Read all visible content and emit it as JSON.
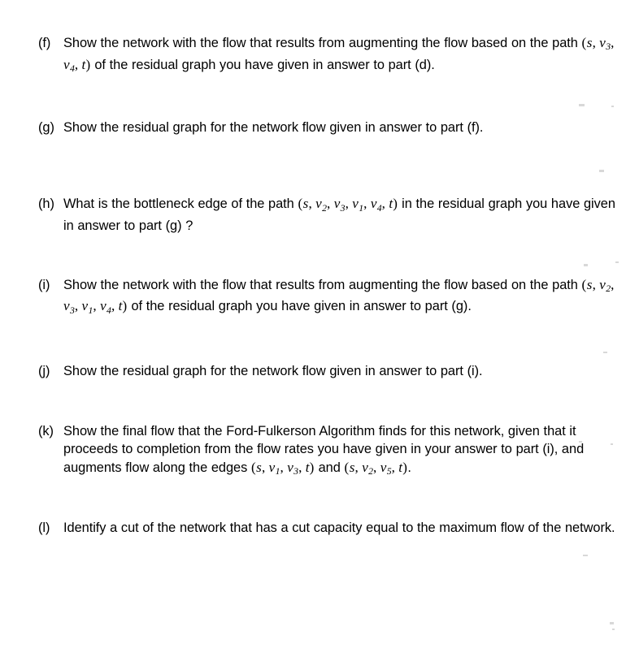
{
  "document": {
    "background_color": "#ffffff",
    "text_color": "#000000"
  },
  "questions": [
    {
      "label": "(f)",
      "name": "question-f",
      "segments": [
        {
          "type": "text",
          "value": "Show the network with the flow that results from augmenting the flow based on the path "
        },
        {
          "type": "math",
          "value": "(s, v3, v4, t)"
        },
        {
          "type": "text",
          "value": " of the residual graph you have given in answer to part (d)."
        }
      ],
      "text": "Show the network with the flow that results from augmenting the flow based on the path (s, v3, v4, t) of the residual graph you have given in answer to part (d)."
    },
    {
      "label": "(g)",
      "name": "question-g",
      "segments": [
        {
          "type": "text",
          "value": "Show the residual graph for the network flow given in answer to part (f)."
        }
      ],
      "text": "Show the residual graph for the network flow given in answer to part (f)."
    },
    {
      "label": "(h)",
      "name": "question-h",
      "segments": [
        {
          "type": "text",
          "value": "What is the bottleneck edge of the path "
        },
        {
          "type": "math",
          "value": "(s, v2, v3, v1, v4, t)"
        },
        {
          "type": "text",
          "value": " in the residual graph you have given in answer to part (g) ?"
        }
      ],
      "text": "What is the bottleneck edge of the path (s, v2, v3, v1, v4, t) in the residual graph you have given in answer to part (g) ?"
    },
    {
      "label": "(i)",
      "name": "question-i",
      "segments": [
        {
          "type": "text",
          "value": "Show the network with the flow that results from augmenting the flow based on the path "
        },
        {
          "type": "math",
          "value": "(s, v2, v3, v1, v4, t)"
        },
        {
          "type": "text",
          "value": " of the residual graph you have given in answer to part (g)."
        }
      ],
      "text": "Show the network with the flow that results from augmenting the flow based on the path (s, v2, v3, v1, v4, t) of the residual graph you have given in answer to part (g)."
    },
    {
      "label": "(j)",
      "name": "question-j",
      "segments": [
        {
          "type": "text",
          "value": "Show the residual graph for the network flow given in answer to part (i)."
        }
      ],
      "text": "Show the residual graph for the network flow given in answer to part (i)."
    },
    {
      "label": "(k)",
      "name": "question-k",
      "segments": [
        {
          "type": "text",
          "value": "Show the final flow that the Ford-Fulkerson Algorithm finds for this network, given that it proceeds to completion from the flow rates you have given in your answer to part (i), and augments flow along the edges "
        },
        {
          "type": "math",
          "value": "(s, v1, v3, t)"
        },
        {
          "type": "text",
          "value": "  and  "
        },
        {
          "type": "math",
          "value": "(s, v2, v5, t)"
        },
        {
          "type": "text",
          "value": "."
        }
      ],
      "text": "Show the final flow that the Ford-Fulkerson Algorithm finds for this network, given that it proceeds to completion from the flow rates you have given in your answer to part (i), and augments flow along the edges (s, v1, v3, t) and (s, v2, v5, t)."
    },
    {
      "label": "(l)",
      "name": "question-l",
      "segments": [
        {
          "type": "text",
          "value": "Identify a cut of the network that has a cut capacity equal to the maximum flow of the network."
        }
      ],
      "text": "Identify a cut of the network that has a cut capacity equal to the maximum flow of the network."
    }
  ]
}
